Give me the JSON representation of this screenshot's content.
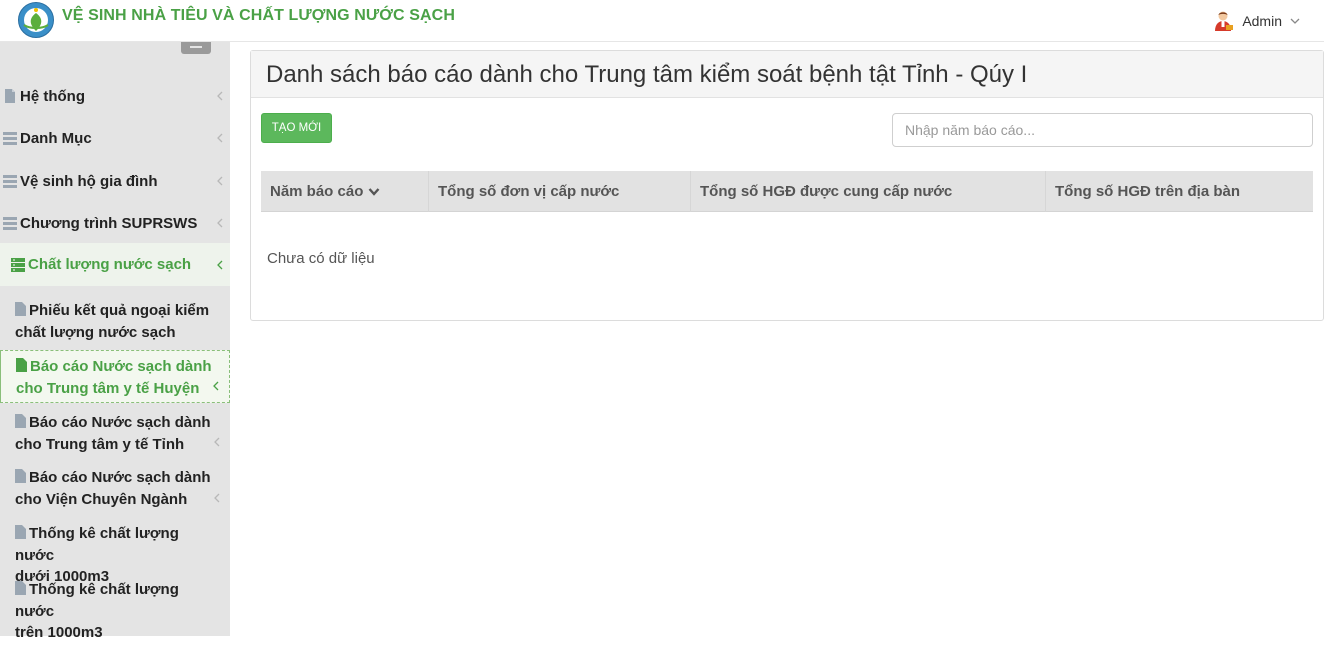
{
  "header": {
    "brand": "VỆ SINH NHÀ TIÊU VÀ CHẤT LƯỢNG NƯỚC SẠCH",
    "user_name": "Admin",
    "brand_color": "#4aa146"
  },
  "sidebar": {
    "items": [
      {
        "label": "Hệ thống",
        "icon": "file-icon"
      },
      {
        "label": "Danh Mục",
        "icon": "list-icon"
      },
      {
        "label": "Vệ sinh hộ gia đình",
        "icon": "list-icon"
      },
      {
        "label": "Chương trình SUPRSWS",
        "icon": "list-icon"
      },
      {
        "label": "Chất lượng nước sạch",
        "icon": "server-icon",
        "active": true
      }
    ],
    "subitems": [
      {
        "line1": "Phiếu kết quả ngoại kiểm",
        "line2": "chất lượng nước sạch"
      },
      {
        "line1": "Báo cáo Nước sạch dành",
        "line2": "cho Trung tâm y tế Huyện",
        "selected": true
      },
      {
        "line1": "Báo cáo Nước sạch dành",
        "line2": "cho Trung tâm y tế Tỉnh"
      },
      {
        "line1": "Báo cáo Nước sạch dành",
        "line2": "cho Viện Chuyên Ngành"
      },
      {
        "line1": "Thống kê chất lượng nước",
        "line2": "dưới 1000m3"
      },
      {
        "line1": "Thống kê chất lượng nước",
        "line2": "trên 1000m3"
      }
    ]
  },
  "main": {
    "title": "Danh sách báo cáo dành cho Trung tâm kiểm soát bệnh tật Tỉnh - Qúy I",
    "new_button": "TẠO MỚI",
    "search_placeholder": "Nhập năm báo cáo...",
    "columns": [
      "Năm báo cáo",
      "Tổng số đơn vị cấp nước",
      "Tổng số HGĐ được cung cấp nước",
      "Tổng số HGĐ trên địa bàn"
    ],
    "empty_text": "Chưa có dữ liệu"
  }
}
